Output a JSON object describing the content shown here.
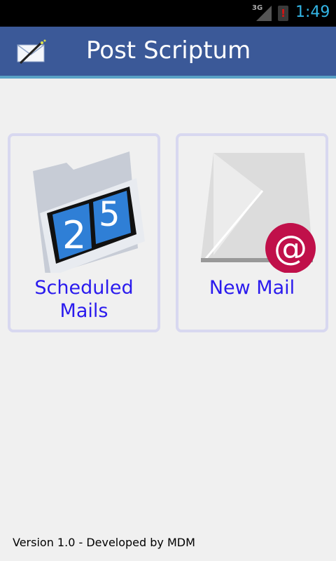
{
  "status_bar": {
    "network": "3G",
    "time": "1:49",
    "battery_alert": "!"
  },
  "app_bar": {
    "title": "Post Scriptum",
    "icon": "envelope-wand-icon"
  },
  "tiles": [
    {
      "label": "Scheduled Mails",
      "icon": "calendar-folder-icon",
      "digits": [
        "2",
        "5"
      ]
    },
    {
      "label": "New Mail",
      "icon": "envelope-at-icon",
      "badge": "@"
    }
  ],
  "footer": "Version 1.0 - Developed by MDM"
}
